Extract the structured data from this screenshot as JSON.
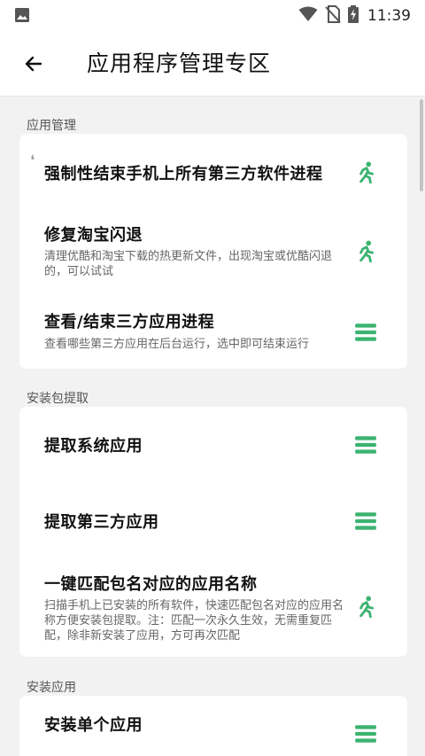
{
  "status_bar": {
    "time": "11:39"
  },
  "app_bar": {
    "title": "应用程序管理专区"
  },
  "sections": [
    {
      "header": "应用管理",
      "items": [
        {
          "title": "强制性结束手机上所有第三方软件进程",
          "desc": "",
          "icon": "run-icon"
        },
        {
          "title": "修复淘宝闪退",
          "desc": "清理优酷和淘宝下载的热更新文件，出现淘宝或优酷闪退的，可以试试",
          "icon": "run-icon"
        },
        {
          "title": "查看/结束三方应用进程",
          "desc": "查看哪些第三方应用在后台运行，选中即可结束运行",
          "icon": "menu-icon"
        }
      ]
    },
    {
      "header": "安装包提取",
      "items": [
        {
          "title": "提取系统应用",
          "desc": "",
          "icon": "menu-icon"
        },
        {
          "title": "提取第三方应用",
          "desc": "",
          "icon": "menu-icon"
        },
        {
          "title": "一键匹配包名对应的应用名称",
          "desc": "扫描手机上已安装的所有软件，快速匹配包名对应的应用名称方便安装包提取。注：匹配一次永久生效，无需重复匹配，除非新安装了应用，方可再次匹配",
          "icon": "run-icon"
        }
      ]
    },
    {
      "header": "安装应用",
      "items": [
        {
          "title": "安装单个应用",
          "desc": "",
          "icon": "menu-icon"
        }
      ]
    }
  ],
  "colors": {
    "accent": "#3cb371",
    "background": "#f2f2f2",
    "card": "#ffffff"
  }
}
